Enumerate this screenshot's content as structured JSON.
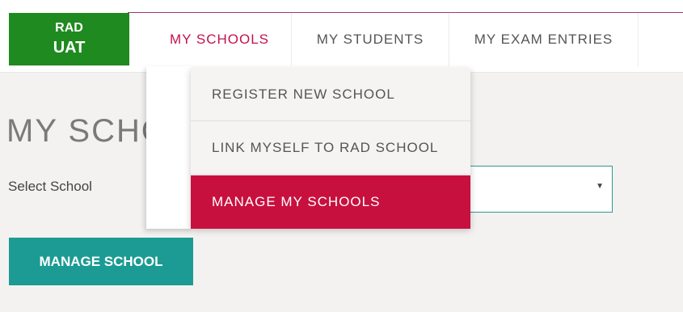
{
  "brand": {
    "line1": "RAD",
    "line2": "UAT",
    "color": "#1f8a1f"
  },
  "nav": {
    "tabs": [
      {
        "label": "MY SCHOOLS",
        "active": true
      },
      {
        "label": "MY STUDENTS",
        "active": false
      },
      {
        "label": "MY EXAM ENTRIES",
        "active": false
      }
    ],
    "active_color": "#c4124a"
  },
  "dropdown": {
    "items": [
      {
        "label": "REGISTER NEW SCHOOL",
        "active": false
      },
      {
        "label": "LINK MYSELF TO RAD SCHOOL",
        "active": false
      },
      {
        "label": "MANAGE MY SCHOOLS",
        "active": true
      }
    ],
    "active_color": "#c8103f"
  },
  "page": {
    "title": "MY SCHOOLS",
    "select_label": "Select School",
    "select_value": "",
    "select_arrow_icon": "caret-down-icon",
    "manage_button": "MANAGE SCHOOL",
    "button_color": "#1b9b93"
  }
}
